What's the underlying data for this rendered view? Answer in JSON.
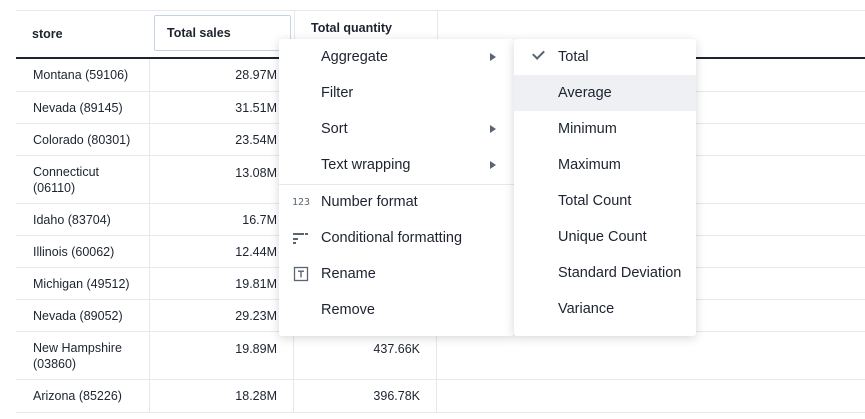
{
  "table": {
    "columns": [
      "store",
      "Total sales",
      "Total quantity"
    ],
    "rows": [
      {
        "store": "Montana (59106)",
        "sales": "28.97M",
        "qty": ""
      },
      {
        "store": "Nevada (89145)",
        "sales": "31.51M",
        "qty": ""
      },
      {
        "store": "Colorado (80301)",
        "sales": "23.54M",
        "qty": ""
      },
      {
        "store": "Connecticut (06110)",
        "sales": "13.08M",
        "qty": ""
      },
      {
        "store": "Idaho (83704)",
        "sales": "16.7M",
        "qty": ""
      },
      {
        "store": "Illinois (60062)",
        "sales": "12.44M",
        "qty": ""
      },
      {
        "store": "Michigan (49512)",
        "sales": "19.81M",
        "qty": ""
      },
      {
        "store": "Nevada (89052)",
        "sales": "29.23M",
        "qty": ""
      },
      {
        "store": "New Hampshire (03860)",
        "sales": "19.89M",
        "qty": "437.66K"
      },
      {
        "store": "Arizona (85226)",
        "sales": "18.28M",
        "qty": "396.78K"
      }
    ]
  },
  "context_menu": {
    "items": [
      {
        "label": "Aggregate",
        "icon": "",
        "submenu": true
      },
      {
        "label": "Filter",
        "icon": "",
        "submenu": false
      },
      {
        "label": "Sort",
        "icon": "",
        "submenu": true
      },
      {
        "label": "Text wrapping",
        "icon": "",
        "submenu": true
      },
      {
        "label": "Number format",
        "icon": "number-format-icon",
        "submenu": false
      },
      {
        "label": "Conditional formatting",
        "icon": "conditional-formatting-icon",
        "submenu": false
      },
      {
        "label": "Rename",
        "icon": "rename-icon",
        "submenu": false
      },
      {
        "label": "Remove",
        "icon": "",
        "submenu": false
      }
    ]
  },
  "aggregate_submenu": {
    "selected": "Total",
    "hovered": "Average",
    "items": [
      "Total",
      "Average",
      "Minimum",
      "Maximum",
      "Total Count",
      "Unique Count",
      "Standard Deviation",
      "Variance"
    ]
  },
  "icon_glyphs": {
    "number_format": "123"
  },
  "colors": {
    "header_border": "#1d232f",
    "grid_line": "#e6e8ee",
    "hover_bg": "#eef0f4",
    "selected_header_border": "#c5d3e6"
  }
}
